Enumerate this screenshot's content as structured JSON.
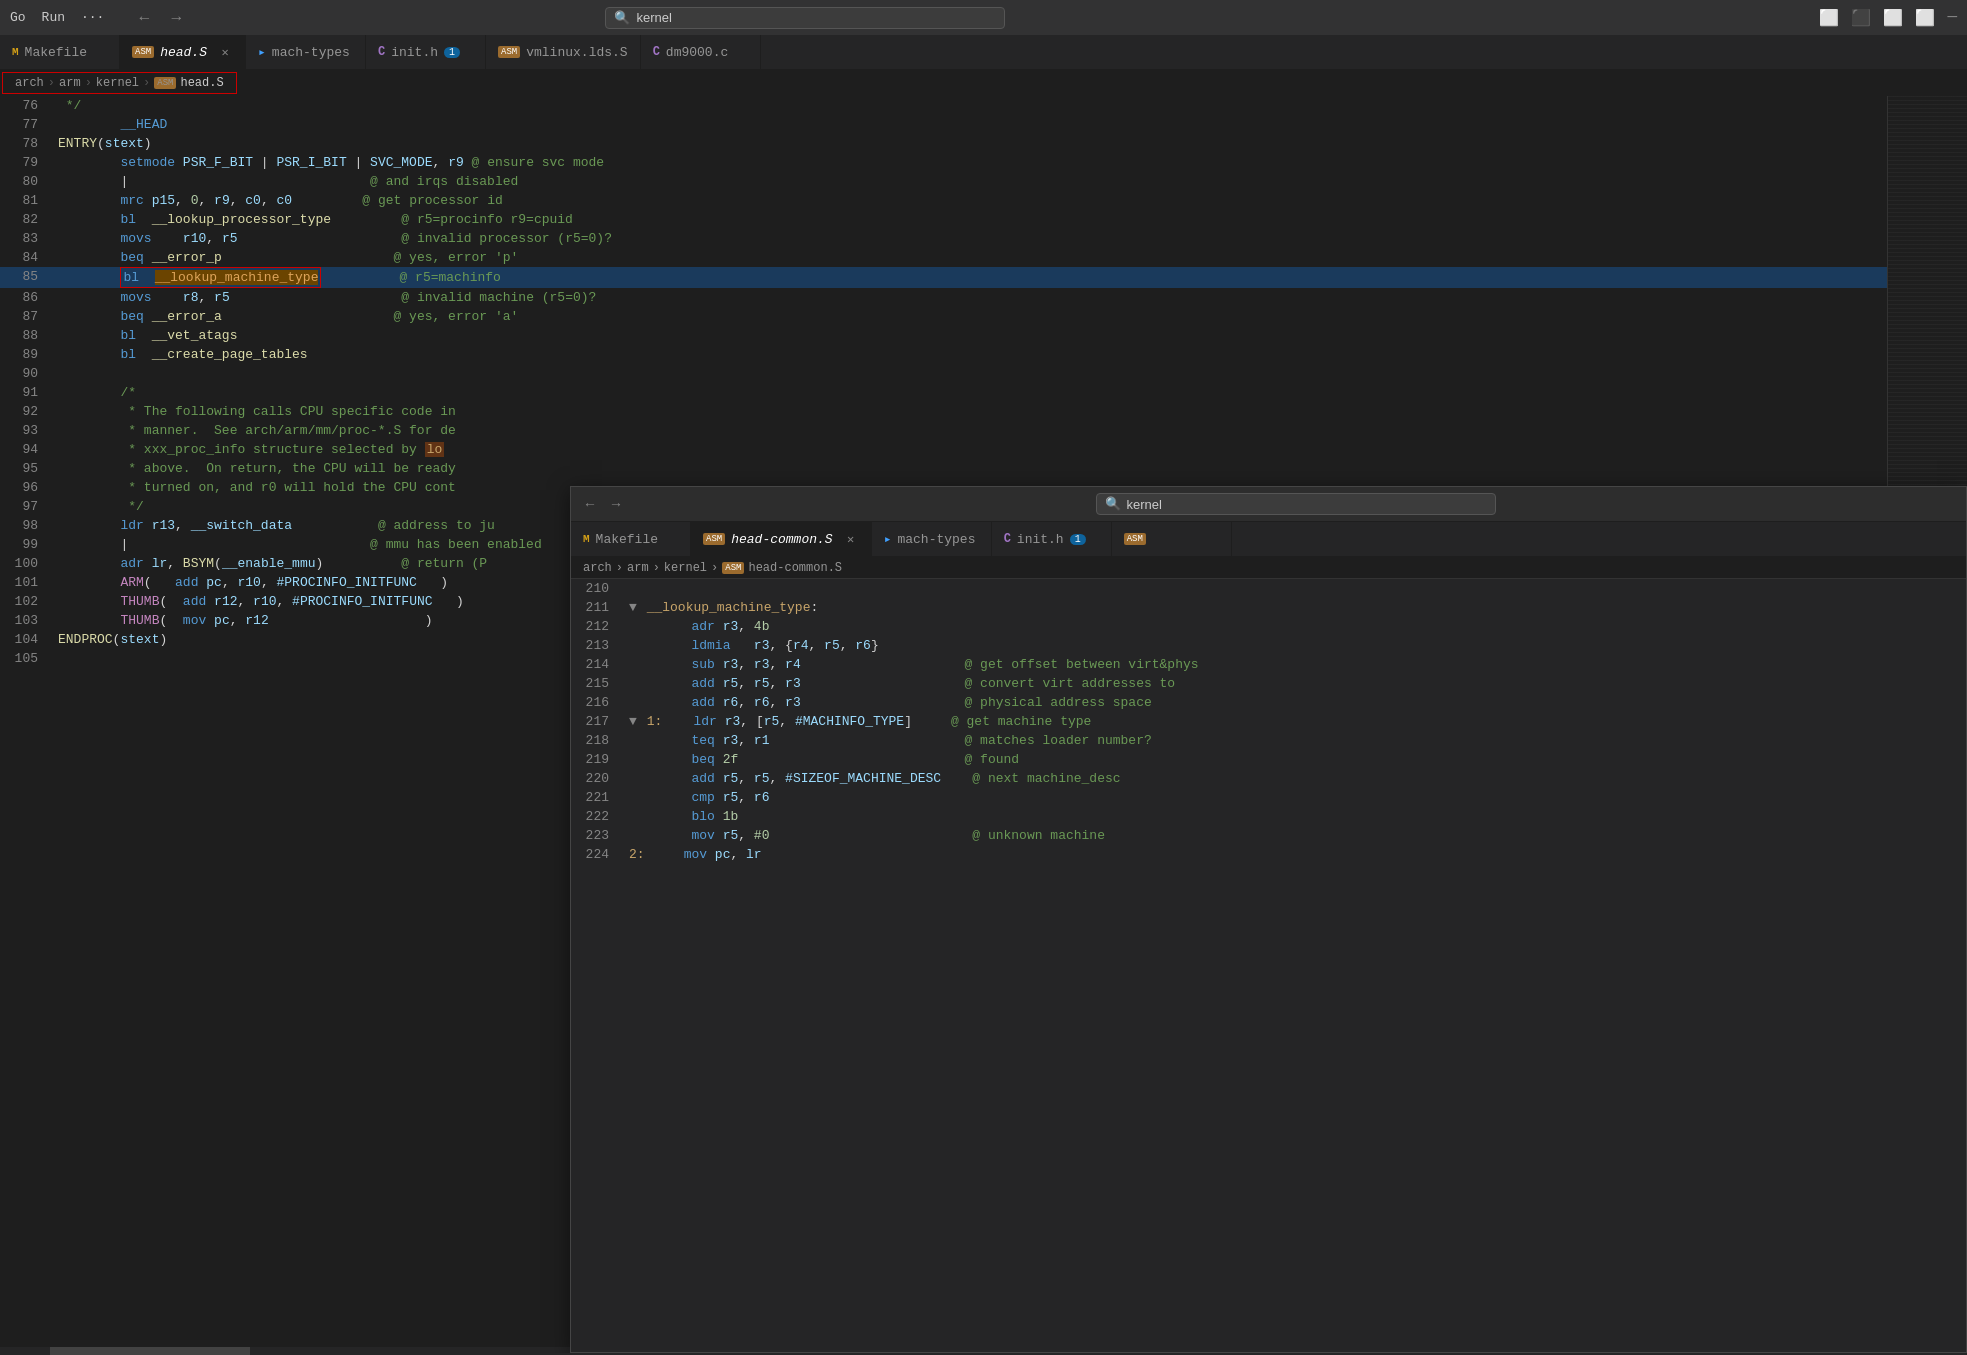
{
  "titlebar": {
    "menu": [
      "Go",
      "Run",
      "···"
    ],
    "search_placeholder": "kernel",
    "nav_back": "←",
    "nav_forward": "→"
  },
  "tabs": [
    {
      "id": "makefile",
      "icon": "M",
      "icon_type": "m",
      "label": "Makefile",
      "active": false,
      "modified": false
    },
    {
      "id": "head-s",
      "icon": "ASM",
      "icon_type": "asm",
      "label": "head.S",
      "active": true,
      "modified": false
    },
    {
      "id": "mach-types",
      "icon": "▸",
      "icon_type": "ts",
      "label": "mach-types",
      "active": false,
      "modified": false
    },
    {
      "id": "init-h",
      "icon": "C",
      "icon_type": "c",
      "label": "init.h",
      "active": false,
      "modified": false,
      "badge": "1"
    },
    {
      "id": "vmlinux-lds",
      "icon": "ASM",
      "icon_type": "asm",
      "label": "vmlinux.lds.S",
      "active": false,
      "modified": false
    },
    {
      "id": "dm9000-c",
      "icon": "C",
      "icon_type": "c",
      "label": "dm9000.c",
      "active": false,
      "modified": false
    }
  ],
  "breadcrumb": {
    "parts": [
      "arch",
      "arm",
      "kernel",
      "head.S"
    ]
  },
  "lines": [
    {
      "num": "76",
      "content": " */"
    },
    {
      "num": "77",
      "content": "\t__HEAD"
    },
    {
      "num": "78",
      "content": "ENTRY(stext)"
    },
    {
      "num": "79",
      "content": "\tsetmode PSR_F_BIT | PSR_I_BIT | SVC_MODE, r9 @ ensure svc mode"
    },
    {
      "num": "80",
      "content": "\t|\t\t\t\t@ and irqs disabled"
    },
    {
      "num": "81",
      "content": "\tmrc p15, 0, r9, c0, c0\t\t@ get processor id"
    },
    {
      "num": "82",
      "content": "\tbl  __lookup_processor_type\t@ r5=procinfo r9=cpuid"
    },
    {
      "num": "83",
      "content": "\tmovs\tr10, r5\t\t\t@ invalid processor (r5=0)?"
    },
    {
      "num": "84",
      "content": "\tbeq __error_p\t\t\t@ yes, error 'p'"
    },
    {
      "num": "85",
      "content": "\tbl  __lookup_machine_type\t@ r5=machinfo",
      "selected": true
    },
    {
      "num": "86",
      "content": "\tmovs\tr8, r5\t\t\t@ invalid machine (r5=0)?"
    },
    {
      "num": "87",
      "content": "\tbeq __error_a\t\t\t@ yes, error 'a'"
    },
    {
      "num": "88",
      "content": "\tbl  __vet_atags"
    },
    {
      "num": "89",
      "content": "\tbl  __create_page_tables"
    },
    {
      "num": "90",
      "content": ""
    },
    {
      "num": "91",
      "content": "\t/*"
    },
    {
      "num": "92",
      "content": "\t * The following calls CPU specific code in"
    },
    {
      "num": "93",
      "content": "\t * manner.  See arch/arm/mm/proc-*.S for de"
    },
    {
      "num": "94",
      "content": "\t * xxx_proc_info structure selected by [lo"
    },
    {
      "num": "95",
      "content": "\t * above.  On return, the CPU will be ready"
    },
    {
      "num": "96",
      "content": "\t * turned on, and r0 will hold the CPU cont"
    },
    {
      "num": "97",
      "content": "\t */"
    },
    {
      "num": "98",
      "content": "\tldr r13, __switch_data\t\t@ address to ju"
    },
    {
      "num": "99",
      "content": "\t|\t\t\t\t@ mmu has been enabled"
    },
    {
      "num": "100",
      "content": "\tadr lr, BSYM(__enable_mmu)\t@ return (P"
    },
    {
      "num": "101",
      "content": "\tARM(\tadd pc, r10, #PROCINFO_INITFUNC\t)"
    },
    {
      "num": "102",
      "content": "\tTHUMB(\tadd r12, r10, #PROCINFO_INITFUNC\t)"
    },
    {
      "num": "103",
      "content": "\tTHUMB(\tmov pc, r12\t\t\t)"
    },
    {
      "num": "104",
      "content": "ENDPROC(stext)"
    },
    {
      "num": "105",
      "content": ""
    }
  ],
  "peek": {
    "search_placeholder": "kernel",
    "tabs": [
      {
        "id": "makefile",
        "icon": "M",
        "icon_type": "m",
        "label": "Makefile",
        "active": false
      },
      {
        "id": "head-common-s",
        "icon": "ASM",
        "icon_type": "asm",
        "label": "head-common.S",
        "active": true
      },
      {
        "id": "mach-types",
        "icon": "▸",
        "icon_type": "ts",
        "label": "mach-types",
        "active": false
      },
      {
        "id": "init-h",
        "icon": "C",
        "icon_type": "c",
        "label": "init.h",
        "active": false,
        "badge": "1"
      }
    ],
    "breadcrumb": {
      "parts": [
        "arch",
        "arm",
        "kernel",
        "head-common.S"
      ]
    },
    "lines": [
      {
        "num": "210",
        "content": ""
      },
      {
        "num": "211",
        "content": "__lookup_machine_type:",
        "fold": true,
        "label": true
      },
      {
        "num": "212",
        "content": "\tadr r3, 4b"
      },
      {
        "num": "213",
        "content": "\tldmia\tr3, {r4, r5, r6}"
      },
      {
        "num": "214",
        "content": "\tsub r3, r3, r4\t\t\t@ get offset between virt&phys"
      },
      {
        "num": "215",
        "content": "\tadd r5, r5, r3\t\t\t@ convert virt addresses to"
      },
      {
        "num": "216",
        "content": "\tadd r6, r6, r3\t\t\t@ physical address space"
      },
      {
        "num": "217",
        "content": "1:\tldr r3, [r5, #MACHINFO_TYPE]\t@ get machine type",
        "fold": true
      },
      {
        "num": "218",
        "content": "\tteq r3, r1\t\t\t@ matches loader number?"
      },
      {
        "num": "219",
        "content": "\tbeq 2f\t\t\t\t@ found"
      },
      {
        "num": "220",
        "content": "\tadd r5, r5, #SIZEOF_MACHINE_DESC\t@ next machine_desc"
      },
      {
        "num": "221",
        "content": "\tcmp r5, r6"
      },
      {
        "num": "222",
        "content": "\tblo 1b"
      },
      {
        "num": "223",
        "content": "\tmov r5, #0\t\t\t@ unknown machine"
      },
      {
        "num": "224",
        "content": "2:\tmov pc, lr"
      }
    ]
  }
}
